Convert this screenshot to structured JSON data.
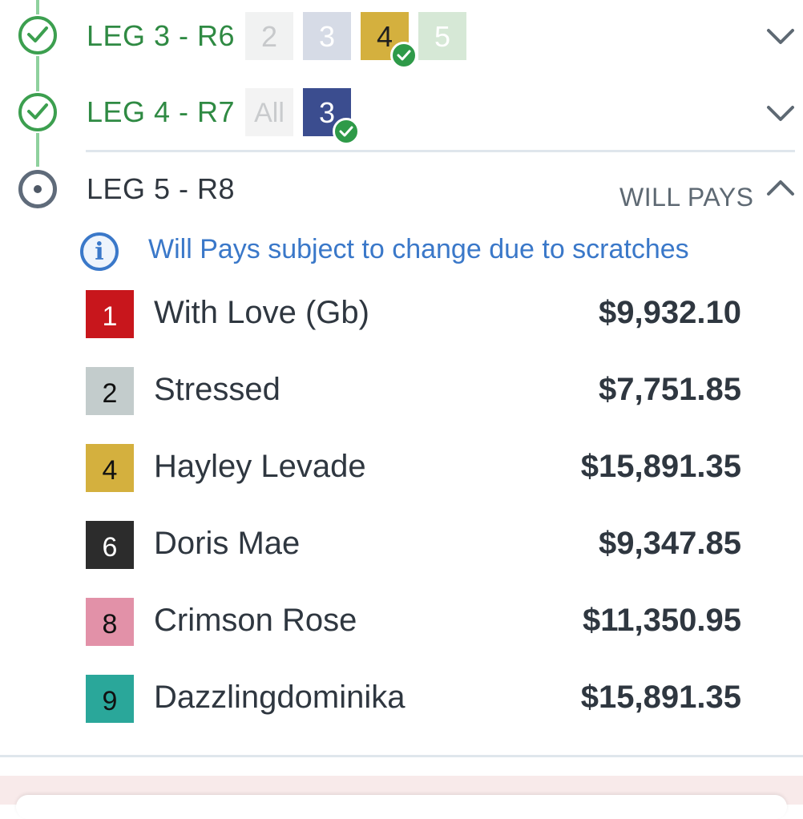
{
  "legs": [
    {
      "title": "LEG 3 - R6",
      "status": "complete",
      "chips": [
        {
          "label": "2",
          "bg": "#f1f2f2",
          "fg": "#c7c9cb",
          "selected": false
        },
        {
          "label": "3",
          "bg": "#d6dbe6",
          "fg": "#ffffff",
          "selected": false
        },
        {
          "label": "4",
          "bg": "#d4b03e",
          "fg": "#1f1f1f",
          "selected": true
        },
        {
          "label": "5",
          "bg": "#d6e8d6",
          "fg": "#ffffff",
          "selected": false
        }
      ]
    },
    {
      "title": "LEG 4 - R7",
      "status": "complete",
      "chips": [
        {
          "label": "All",
          "bg": "#f3f3f3",
          "fg": "#c9cbcd",
          "selected": false
        },
        {
          "label": "3",
          "bg": "#3b4d8f",
          "fg": "#ffffff",
          "selected": true
        }
      ]
    },
    {
      "title": "LEG 5 - R8",
      "status": "current"
    }
  ],
  "will_pays": {
    "label": "WILL PAYS",
    "notice": "Will Pays subject to change due to scratches",
    "runners": [
      {
        "number": "1",
        "name": "With Love (Gb)",
        "pay": "$9,932.10",
        "bg": "#c8161c",
        "fg": "#ffffff"
      },
      {
        "number": "2",
        "name": "Stressed",
        "pay": "$7,751.85",
        "bg": "#c3cccc",
        "fg": "#111111"
      },
      {
        "number": "4",
        "name": "Hayley Levade",
        "pay": "$15,891.35",
        "bg": "#d4b03e",
        "fg": "#111111"
      },
      {
        "number": "6",
        "name": "Doris Mae",
        "pay": "$9,347.85",
        "bg": "#2c2c2c",
        "fg": "#ffffff"
      },
      {
        "number": "8",
        "name": "Crimson Rose",
        "pay": "$11,350.95",
        "bg": "#e291a8",
        "fg": "#111111"
      },
      {
        "number": "9",
        "name": "Dazzlingdominika",
        "pay": "$15,891.35",
        "bg": "#2aa79a",
        "fg": "#111111"
      }
    ]
  },
  "icons": {
    "complete": "check-circle-icon",
    "current": "radio-dot-icon",
    "collapsed": "chevron-down-icon",
    "expanded": "chevron-up-icon",
    "info": "info-icon"
  }
}
